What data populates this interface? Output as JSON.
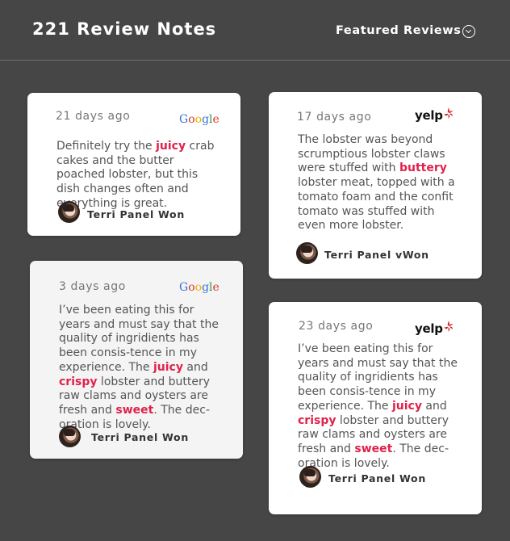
{
  "header": {
    "title": "221 Review Notes",
    "featured_label": "Featured Reviews"
  },
  "colors": {
    "background": "#464646",
    "highlight": "#e0224b",
    "card": "#ffffff",
    "card_alt": "#f4f4f4"
  },
  "reviews": [
    {
      "date": "21 days ago",
      "source": "Google",
      "body": [
        {
          "t": "Definitely try the "
        },
        {
          "t": "juicy",
          "hl": true
        },
        {
          "t": " crab cakes and the butter poached lobster, but this dish changes often and everything is great."
        }
      ],
      "author": "Terri Panel Won"
    },
    {
      "date": "17 days ago",
      "source": "yelp",
      "body": [
        {
          "t": "The lobster was beyond scrumptious lobster claws were stuffed with "
        },
        {
          "t": "buttery",
          "hl": true
        },
        {
          "t": " lobster meat, topped with a tomato foam and the confit tomato was stuffed with even more lobster."
        }
      ],
      "author": "Terri Panel vWon"
    },
    {
      "date": "3 days ago",
      "source": "Google",
      "body": [
        {
          "t": "I’ve been eating this for years and must say that the quality of ingridients has been consis-tence in my experience. The "
        },
        {
          "t": "juicy",
          "hl": true
        },
        {
          "t": " and "
        },
        {
          "t": "crispy",
          "hl": true
        },
        {
          "t": " lobster and buttery raw clams and oysters are fresh and "
        },
        {
          "t": "sweet",
          "hl": true
        },
        {
          "t": ". The dec-oration is lovely."
        }
      ],
      "author": "Terri Panel Won"
    },
    {
      "date": "23 days ago",
      "source": "yelp",
      "body": [
        {
          "t": "I’ve been eating this for years and must say that the quality of ingridients has been consis-tence in my experience. The "
        },
        {
          "t": "juicy",
          "hl": true
        },
        {
          "t": " and "
        },
        {
          "t": "crispy",
          "hl": true
        },
        {
          "t": " lobster and buttery raw clams and oysters are fresh and "
        },
        {
          "t": "sweet",
          "hl": true
        },
        {
          "t": ". The dec-oration is lovely."
        }
      ],
      "author": "Terri Panel Won"
    }
  ]
}
